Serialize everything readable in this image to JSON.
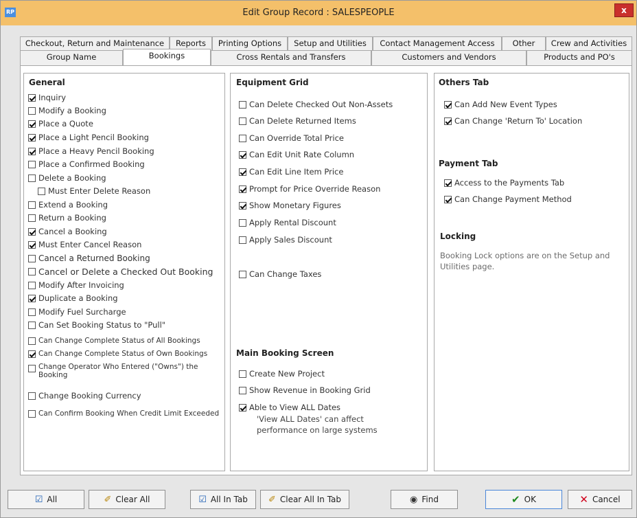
{
  "window": {
    "app_icon": "RP",
    "title": "Edit Group Record : SALESPEOPLE",
    "close": "x"
  },
  "tabs_row1": [
    "Checkout, Return and Maintenance",
    "Reports",
    "Printing Options",
    "Setup and Utilities",
    "Contact Management Access",
    "Other",
    "Crew and Activities"
  ],
  "tabs_row2": [
    "Group Name",
    "Bookings",
    "Cross Rentals and Transfers",
    "Customers and Vendors",
    "Products and PO's"
  ],
  "general": {
    "title": "General",
    "items": [
      {
        "label": "Inquiry",
        "checked": true
      },
      {
        "label": "Modify a Booking",
        "checked": false
      },
      {
        "label": "Place a Quote",
        "checked": true
      },
      {
        "label": "Place a Light Pencil Booking",
        "checked": true
      },
      {
        "label": "Place a Heavy Pencil Booking",
        "checked": true
      },
      {
        "label": "Place a Confirmed Booking",
        "checked": false
      },
      {
        "label": "Delete a Booking",
        "checked": false
      },
      {
        "label": "Must Enter Delete Reason",
        "checked": false
      },
      {
        "label": "Extend a Booking",
        "checked": false
      },
      {
        "label": "Return a Booking",
        "checked": false
      },
      {
        "label": "Cancel a Booking",
        "checked": true
      },
      {
        "label": "Must Enter Cancel Reason",
        "checked": true
      },
      {
        "label": "Cancel a Returned Booking",
        "checked": false
      },
      {
        "label": "Cancel or Delete a Checked Out Booking",
        "checked": false
      },
      {
        "label": "Modify After Invoicing",
        "checked": false
      },
      {
        "label": "Duplicate a Booking",
        "checked": true
      },
      {
        "label": "Modify Fuel Surcharge",
        "checked": false
      },
      {
        "label": "Can Set Booking Status to \"Pull\"",
        "checked": false
      },
      {
        "label": "Can Change Complete Status of All Bookings",
        "checked": false
      },
      {
        "label": "Can Change Complete Status of Own Bookings",
        "checked": true
      },
      {
        "label": "Change Operator Who Entered (\"Owns\") the Booking",
        "checked": false
      },
      {
        "label": "Change Booking Currency",
        "checked": false
      },
      {
        "label": "Can Confirm Booking When Credit Limit Exceeded",
        "checked": false
      }
    ]
  },
  "equipment": {
    "title": "Equipment Grid",
    "items": [
      {
        "label": "Can Delete Checked Out Non-Assets",
        "checked": false
      },
      {
        "label": "Can Delete Returned Items",
        "checked": false
      },
      {
        "label": "Can Override Total Price",
        "checked": false
      },
      {
        "label": "Can Edit Unit Rate Column",
        "checked": true
      },
      {
        "label": "Can Edit Line Item Price",
        "checked": true
      },
      {
        "label": "Prompt for Price Override Reason",
        "checked": true
      },
      {
        "label": "Show Monetary Figures",
        "checked": true
      },
      {
        "label": "Apply Rental Discount",
        "checked": false
      },
      {
        "label": "Apply Sales Discount",
        "checked": false
      },
      {
        "label": "Can Change Taxes",
        "checked": false
      }
    ]
  },
  "main_booking": {
    "title": "Main Booking Screen",
    "items": [
      {
        "label": "Create New Project",
        "checked": false
      },
      {
        "label": "Show Revenue in Booking Grid",
        "checked": false
      },
      {
        "label": "Able to View ALL Dates",
        "checked": true
      }
    ],
    "note_line1": "'View ALL Dates' can affect",
    "note_line2": "performance on large systems"
  },
  "others": {
    "title": "Others Tab",
    "items": [
      {
        "label": "Can Add New Event Types",
        "checked": true
      },
      {
        "label": "Can Change 'Return To' Location",
        "checked": true
      }
    ]
  },
  "payment": {
    "title": "Payment Tab",
    "items": [
      {
        "label": "Access to the Payments Tab",
        "checked": true
      },
      {
        "label": "Can Change Payment Method",
        "checked": true
      }
    ]
  },
  "locking": {
    "title": "Locking",
    "note_line1": "Booking Lock options are on the Setup and",
    "note_line2": "Utilities page."
  },
  "buttons": {
    "all": "All",
    "clear_all": "Clear All",
    "all_in_tab": "All In Tab",
    "clear_all_in_tab": "Clear All In Tab",
    "find": "Find",
    "ok": "OK",
    "cancel": "Cancel"
  },
  "colors": {
    "titlebar": "#f4c06a",
    "close": "#c9302c",
    "ok_check": "#1f8a1f",
    "cancel_x": "#d0021b"
  }
}
